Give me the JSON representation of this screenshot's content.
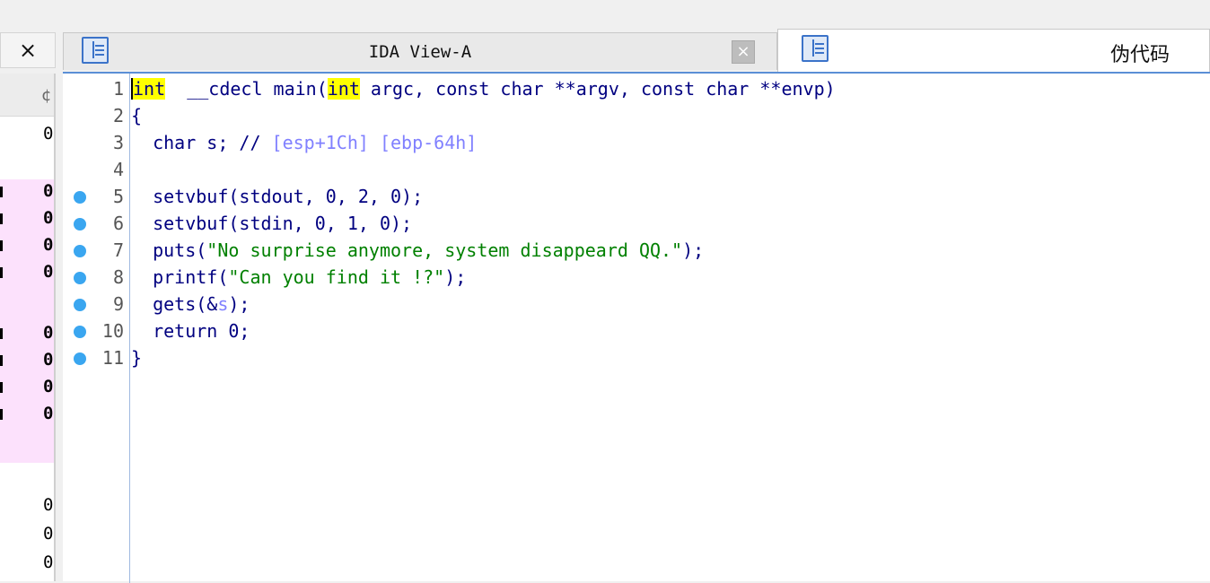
{
  "left_panel": {
    "close_glyph": "×",
    "header_glyph": "¢",
    "values": [
      "0",
      "0",
      "0",
      "0",
      "0",
      "0",
      "0",
      "0",
      "0",
      "0",
      "0",
      "0"
    ]
  },
  "tabs": [
    {
      "title": "IDA View-A",
      "icon": "pseudo-icon",
      "close_glyph": "×",
      "active": false
    },
    {
      "title": "伪代码",
      "icon": "pseudo-icon",
      "active": true
    }
  ],
  "code": {
    "lines": [
      {
        "no": "1",
        "bp": false,
        "parts": [
          [
            "kw",
            "int"
          ],
          [
            "",
            "  __cdecl main("
          ],
          [
            "kw",
            "int"
          ],
          [
            "",
            " argc, const char **argv, const char **envp)"
          ]
        ]
      },
      {
        "no": "2",
        "bp": false,
        "parts": [
          [
            "",
            "{"
          ]
        ]
      },
      {
        "no": "3",
        "bp": false,
        "parts": [
          [
            "",
            "  char s; // "
          ],
          [
            "cmt",
            "[esp+1Ch] [ebp-64h]"
          ]
        ]
      },
      {
        "no": "4",
        "bp": false,
        "parts": [
          [
            "",
            ""
          ]
        ]
      },
      {
        "no": "5",
        "bp": true,
        "parts": [
          [
            "",
            "  setvbuf(stdout, 0, 2, 0);"
          ]
        ]
      },
      {
        "no": "6",
        "bp": true,
        "parts": [
          [
            "",
            "  setvbuf(stdin, 0, 1, 0);"
          ]
        ]
      },
      {
        "no": "7",
        "bp": true,
        "parts": [
          [
            "",
            "  puts("
          ],
          [
            "str",
            "\"No surprise anymore, system disappeard QQ.\""
          ],
          [
            "",
            ");"
          ]
        ]
      },
      {
        "no": "8",
        "bp": true,
        "parts": [
          [
            "",
            "  printf("
          ],
          [
            "str",
            "\"Can you find it !?\""
          ],
          [
            "",
            ");"
          ]
        ]
      },
      {
        "no": "9",
        "bp": true,
        "parts": [
          [
            "",
            "  gets(&"
          ],
          [
            "var-gray",
            "s"
          ],
          [
            "",
            ");"
          ]
        ]
      },
      {
        "no": "10",
        "bp": true,
        "parts": [
          [
            "",
            "  return 0;"
          ]
        ]
      },
      {
        "no": "11",
        "bp": true,
        "parts": [
          [
            "",
            "}"
          ]
        ]
      }
    ]
  }
}
